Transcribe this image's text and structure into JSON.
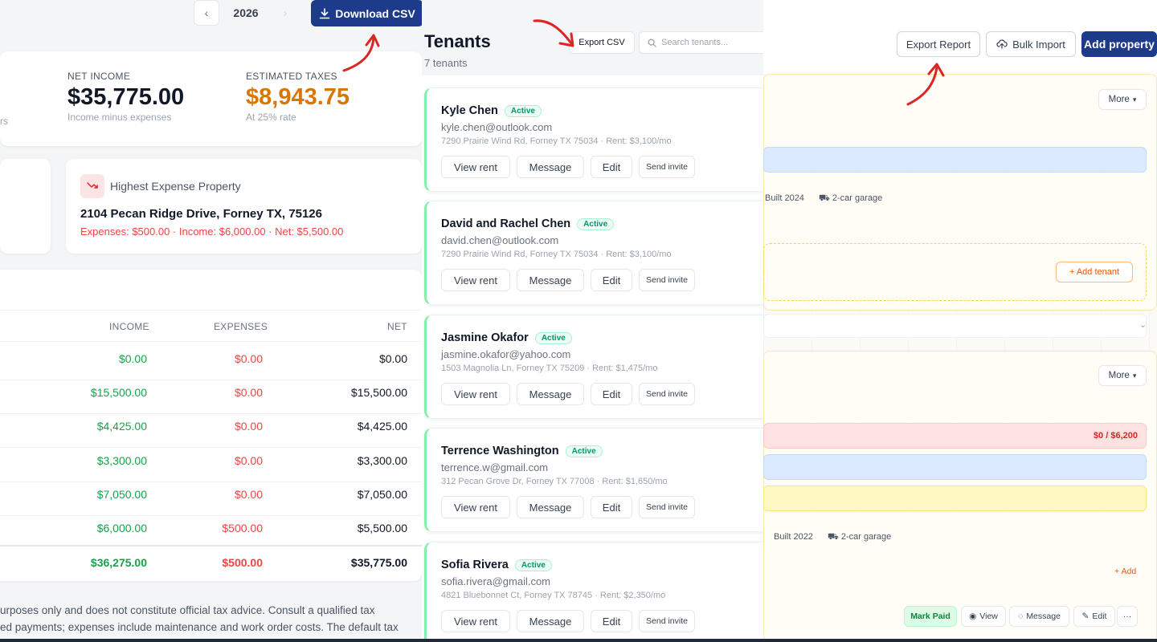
{
  "finance": {
    "year": "2026",
    "download_label": "Download CSV",
    "sum_trunc": "rs",
    "net_income": {
      "label": "NET INCOME",
      "value": "$35,775.00",
      "sub": "Income minus expenses"
    },
    "estimated_taxes": {
      "label": "ESTIMATED TAXES",
      "value": "$8,943.75",
      "sub": "At 25% rate",
      "color": "#d97706"
    },
    "highest_expense": {
      "title": "Highest Expense Property",
      "address": "2104 Pecan Ridge Drive, Forney TX, 75126",
      "stats": "Expenses: $500.00 · Income: $6,000.00 · Net: $5,500.00"
    },
    "table": {
      "headers": {
        "income": "INCOME",
        "expenses": "EXPENSES",
        "net": "NET"
      },
      "rows": [
        {
          "income": "$0.00",
          "expenses": "$0.00",
          "net": "$0.00"
        },
        {
          "income": "$15,500.00",
          "expenses": "$0.00",
          "net": "$15,500.00"
        },
        {
          "income": "$4,425.00",
          "expenses": "$0.00",
          "net": "$4,425.00"
        },
        {
          "income": "$3,300.00",
          "expenses": "$0.00",
          "net": "$3,300.00"
        },
        {
          "income": "$7,050.00",
          "expenses": "$0.00",
          "net": "$7,050.00"
        },
        {
          "income": "$6,000.00",
          "expenses": "$500.00",
          "net": "$5,500.00"
        }
      ],
      "total": {
        "income": "$36,275.00",
        "expenses": "$500.00",
        "net": "$35,775.00"
      }
    },
    "disclaimer_1": "urposes only and does not constitute official tax advice. Consult a qualified tax",
    "disclaimer_2": "ed payments; expenses include maintenance and work order costs. The default tax"
  },
  "tenants": {
    "title": "Tenants",
    "count": "7 tenants",
    "export_label": "Export CSV",
    "search_placeholder": "Search tenants...",
    "buttons": {
      "view_rent": "View rent",
      "message": "Message",
      "edit": "Edit",
      "send_invite": "Send invite"
    },
    "list": [
      {
        "name": "Kyle Chen",
        "status": "Active",
        "email": "kyle.chen@outlook.com",
        "address": "7290 Prairie Wind Rd, Forney TX 75034 · Rent: $3,100/mo"
      },
      {
        "name": "David and Rachel Chen",
        "status": "Active",
        "email": "david.chen@outlook.com",
        "address": "7290 Prairie Wind Rd, Forney TX 75034 · Rent: $3,100/mo"
      },
      {
        "name": "Jasmine Okafor",
        "status": "Active",
        "email": "jasmine.okafor@yahoo.com",
        "address": "1503 Magnolia Ln, Forney TX 75209 · Rent: $1,475/mo"
      },
      {
        "name": "Terrence Washington",
        "status": "Active",
        "email": "terrence.w@gmail.com",
        "address": "312 Pecan Grove Dr, Forney TX 77008 · Rent: $1,650/mo"
      },
      {
        "name": "Sofia Rivera",
        "status": "Active",
        "email": "sofia.rivera@gmail.com",
        "address": "4821 Bluebonnet Ct, Forney TX 78745 · Rent: $2,350/mo"
      }
    ]
  },
  "properties": {
    "export_report": "Export Report",
    "bulk_import": "Bulk Import",
    "add_property": "Add property",
    "more": "More",
    "card1": {
      "built": "Built 2024",
      "garage": "2-car garage",
      "add_tenant": "+ Add tenant"
    },
    "card2": {
      "rent_status": "$0 / $6,200",
      "built": "Built 2022",
      "garage": "2-car garage",
      "add": "+ Add"
    },
    "actions": {
      "mark_paid": "Mark Paid",
      "view": "View",
      "message": "Message",
      "edit": "Edit",
      "more": "···"
    }
  },
  "colors": {
    "primary": "#1e3a8a",
    "income": "#16a34a",
    "expense": "#ef4444",
    "tax": "#d97706"
  }
}
